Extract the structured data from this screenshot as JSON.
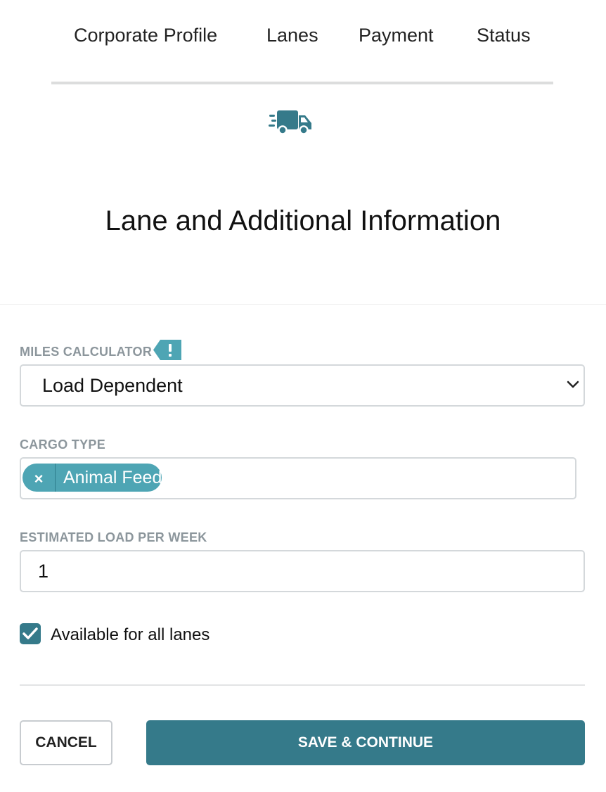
{
  "steps": [
    {
      "label": "Corporate Profile"
    },
    {
      "label": "Lanes"
    },
    {
      "label": "Payment"
    },
    {
      "label": "Status"
    }
  ],
  "page_title": "Lane and Additional Information",
  "header_icon": "truck-icon",
  "miles_calculator": {
    "label": "MILES CALCULATOR",
    "badge_icon": "exclamation-icon",
    "value": "Load Dependent"
  },
  "cargo_type": {
    "label": "CARGO TYPE",
    "tags": [
      {
        "label": "Animal Feed",
        "remove_symbol": "×"
      }
    ]
  },
  "estimated_load": {
    "label": "ESTIMATED LOAD PER WEEK",
    "value": "1"
  },
  "available_all_lanes": {
    "label": "Available for all lanes",
    "checked": true
  },
  "actions": {
    "cancel_label": "CANCEL",
    "save_label": "SAVE & CONTINUE"
  },
  "colors": {
    "accent": "#357a8a",
    "tag": "#4ea5b4",
    "badge": "#4ea5b4",
    "label": "#8c969c"
  }
}
